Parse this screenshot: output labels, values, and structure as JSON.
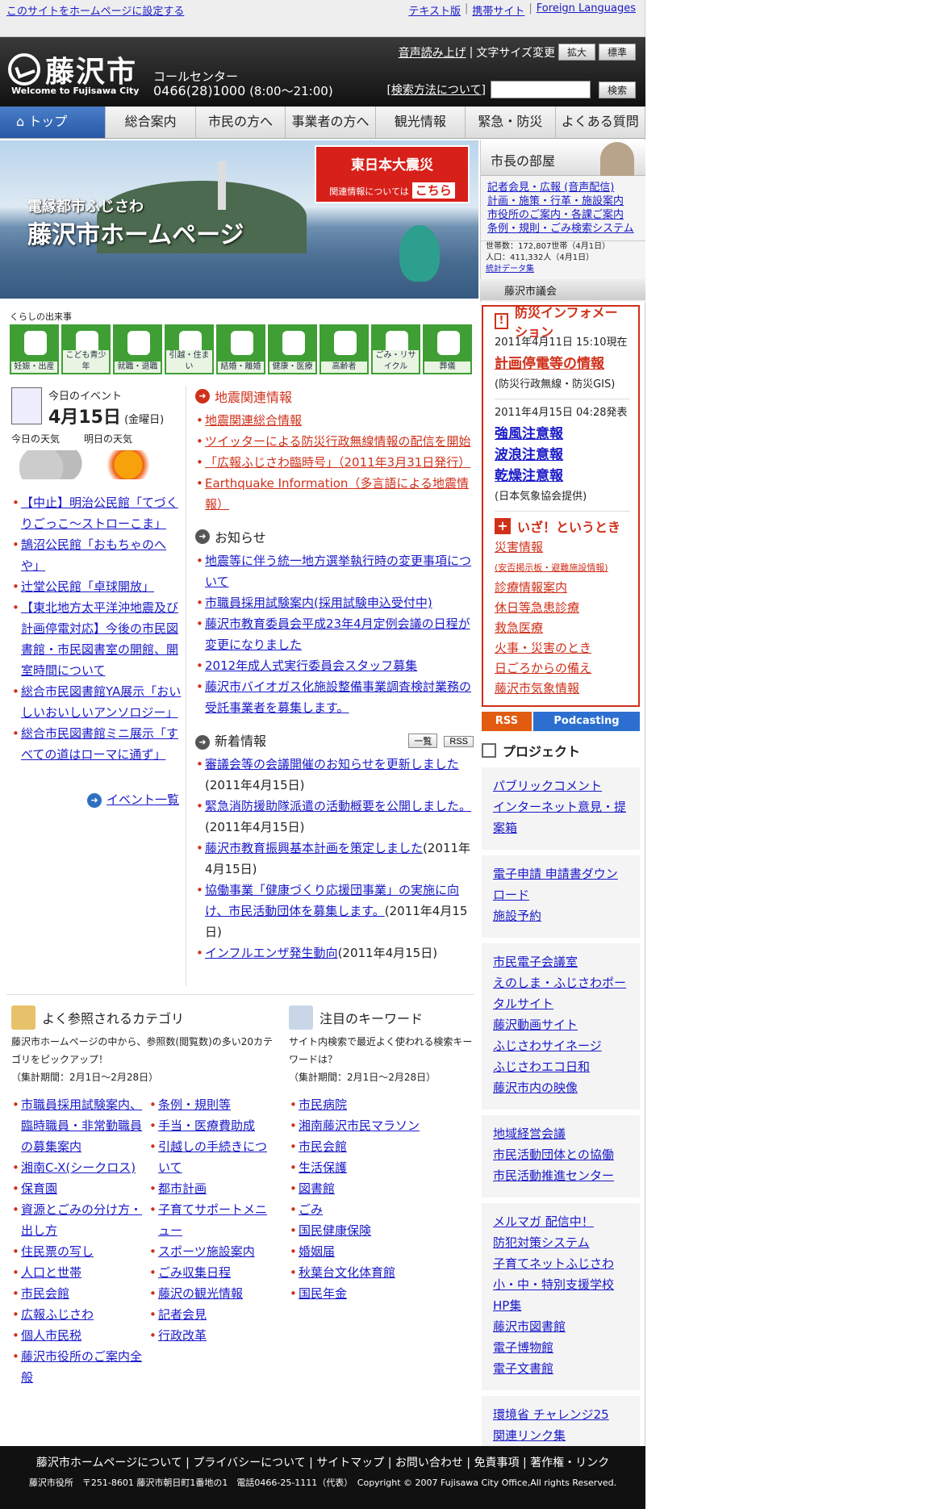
{
  "topbar": {
    "set_homepage": "このサイトをホームページに設定する",
    "links": [
      "テキスト版",
      "携帯サイト",
      "Foreign Languages"
    ]
  },
  "header": {
    "city": "藤沢市",
    "welcome": "Welcome to Fujisawa City",
    "call_center": "コールセンター",
    "phone": "0466(28)1000",
    "hours": "(8:00～21:00)",
    "voice": "音声読み上げ",
    "text_size": "文字サイズ変更",
    "enlarge": "拡大",
    "standard": "標準",
    "search_help": "[検索方法について]",
    "search_button": "検索"
  },
  "nav": [
    "トップ",
    "総合案内",
    "市民の方へ",
    "事業者の方へ",
    "観光情報",
    "緊急・防災",
    "よくある質問"
  ],
  "hero": {
    "subtitle": "電縁都市ふじさわ",
    "title": "藤沢市ホームページ",
    "quake_title": "東日本大震災",
    "quake_sub": "関連情報については",
    "quake_link": "こちら"
  },
  "mayor": {
    "title": "市長の部屋",
    "links": [
      "記者会見・広報 (音声配信)",
      "計画・施策・行革・施設案内",
      "市役所のご案内・各課ご案内",
      "条例・規則・ごみ検索システム"
    ],
    "households": "世帯数：172,807世帯（4月1日）",
    "population": "人口：411,332人（4月1日）",
    "stats_link": "統計データ集",
    "council": "藤沢市議会"
  },
  "life": {
    "heading": "くらしの出来事",
    "items": [
      "妊娠・出産",
      "こども青少年",
      "就職・退職",
      "引越・住まい",
      "結婚・離婚",
      "健康・医療",
      "高齢者",
      "ごみ・リサイクル",
      "葬儀"
    ]
  },
  "events": {
    "heading": "今日のイベント",
    "month": "4月",
    "day": "15日",
    "weekday": "(金曜日)",
    "today_weather": "今日の天気",
    "tomorrow_weather": "明日の天気",
    "items": [
      "【中止】明治公民館「てづくりごっこ～ストローこま」",
      "鵠沼公民館「おもちゃのへや」",
      "辻堂公民館「卓球開放」",
      "【東北地方太平洋沖地震及び計画停電対応】今後の市民図書館・市民図書室の開館、開室時間について",
      "総合市民図書館YA展示「おいしいおいしいアンソロジー」",
      "総合市民図書館ミニ展示「すべての道はローマに通ず」"
    ],
    "more": "イベント一覧"
  },
  "quake_info": {
    "heading": "地震関連情報",
    "items": [
      "地震関連総合情報",
      "ツイッターによる防災行政無線情報の配信を開始",
      "「広報ふじさわ臨時号」（2011年3月31日発行）",
      "Earthquake Information（多言語による地震情報）"
    ]
  },
  "notices": {
    "heading": "お知らせ",
    "items": [
      "地震等に伴う統一地方選挙執行時の変更事項について",
      "市職員採用試験案内(採用試験申込受付中)",
      "藤沢市教育委員会平成23年4月定例会議の日程が変更になりました",
      "2012年成人式実行委員会スタッフ募集",
      "藤沢市バイオガス化施設整備事業調査検討業務の受託事業者を募集します。"
    ]
  },
  "whats_new": {
    "heading": "新着情報",
    "list_button": "一覧",
    "rss_button": "RSS",
    "items": [
      {
        "text": "審議会等の会議開催のお知らせを更新しました",
        "date": "(2011年4月15日)"
      },
      {
        "text": "緊急消防援助隊派遣の活動概要を公開しました。",
        "date": "(2011年4月15日)"
      },
      {
        "text": "藤沢市教育振興基本計画を策定しました",
        "date": "(2011年4月15日)"
      },
      {
        "text": "協働事業「健康づくり応援団事業」の実施に向け、市民活動団体を募集します。",
        "date": "(2011年4月15日)"
      },
      {
        "text": "インフルエンザ発生動向",
        "date": "(2011年4月15日)"
      }
    ]
  },
  "categories": {
    "heading": "よく参照されるカテゴリ",
    "desc": "藤沢市ホームページの中から、参照数(閲覧数)の多い20カテゴリをピックアップ！",
    "period": "（集計期間：2月1日～2月28日）",
    "col1": [
      "市職員採用試験案内、臨時職員・非常勤職員の募集案内",
      "湘南C-X(シークロス)",
      "保育園",
      "資源とごみの分け方・出し方",
      "住民票の写し",
      "人口と世帯",
      "市民会館",
      "広報ふじさわ",
      "個人市民税",
      "藤沢市役所のご案内全般"
    ],
    "col2": [
      "条例・規則等",
      "手当・医療費助成",
      "引越しの手続きについて",
      "都市計画",
      "子育てサポートメニュー",
      "スポーツ施設案内",
      "ごみ収集日程",
      "藤沢の観光情報",
      "記者会見",
      "行政改革"
    ]
  },
  "keywords": {
    "heading": "注目のキーワード",
    "desc": "サイト内検索で最近よく使われる検索キーワードは？",
    "period": "（集計期間：2月1日～2月28日）",
    "items": [
      "市民病院",
      "湘南藤沢市民マラソン",
      "市民会館",
      "生活保護",
      "図書館",
      "ごみ",
      "国民健康保険",
      "婚姻届",
      "秋葉台文化体育館",
      "国民年金"
    ]
  },
  "disaster": {
    "heading": "防災インフォメーション",
    "time1": "2011年4月11日 15:10現在",
    "outage": "計画停電等の情報",
    "outage_note": "(防災行政無線・防災GIS)",
    "time2": "2011年4月15日 04:28発表",
    "warnings": [
      "強風注意報",
      "波浪注意報",
      "乾燥注意報"
    ],
    "source": "(日本気象協会提供)",
    "emergency_heading": "いざ！というとき",
    "emergency": [
      "災害情報",
      "(安否掲示板・避難施設情報)",
      "診療情報案内",
      "休日等急患診療",
      "救急医療",
      "火事・災害のとき",
      "日ごろからの備え",
      "藤沢市気象情報"
    ]
  },
  "feeds": {
    "rss": "RSS",
    "podcast": "Podcasting"
  },
  "project": {
    "heading": "プロジェクト",
    "groups": [
      [
        "パブリックコメント",
        "インターネット意見・提案箱"
      ],
      [
        "電子申請 申請書ダウンロード",
        "施設予約"
      ],
      [
        "市民電子会議室",
        "えのしま・ふじさわポータルサイト",
        "藤沢動画サイト",
        "ふじさわサイネージ",
        "ふじさわエコ日和",
        "藤沢市内の映像"
      ],
      [
        "地域経営会議",
        "市民活動団体との協働",
        "市民活動推進センター"
      ],
      [
        "メルマガ 配信中！",
        "防犯対策システム",
        "子育てネットふじさわ",
        "小・中・特別支援学校HP集",
        "藤沢市図書館",
        "電子博物館",
        "電子文書館"
      ],
      [
        "環境省 チャレンジ25",
        "関連リンク集"
      ]
    ]
  },
  "footer": {
    "links": [
      "藤沢市ホームページについて",
      "プライバシーについて",
      "サイトマップ",
      "お問い合わせ",
      "免責事項",
      "著作権・リンク"
    ],
    "address": "藤沢市役所　〒251-8601 藤沢市朝日町1番地の1　電話0466-25-1111（代表）　Copyright © 2007 Fujisawa City Office,All rights Reserved."
  },
  "colors": {
    "accent_red": "#d0301a",
    "nav_blue": "#2658a6",
    "life_green": "#3f9f34",
    "link": "#1a1ac8"
  }
}
